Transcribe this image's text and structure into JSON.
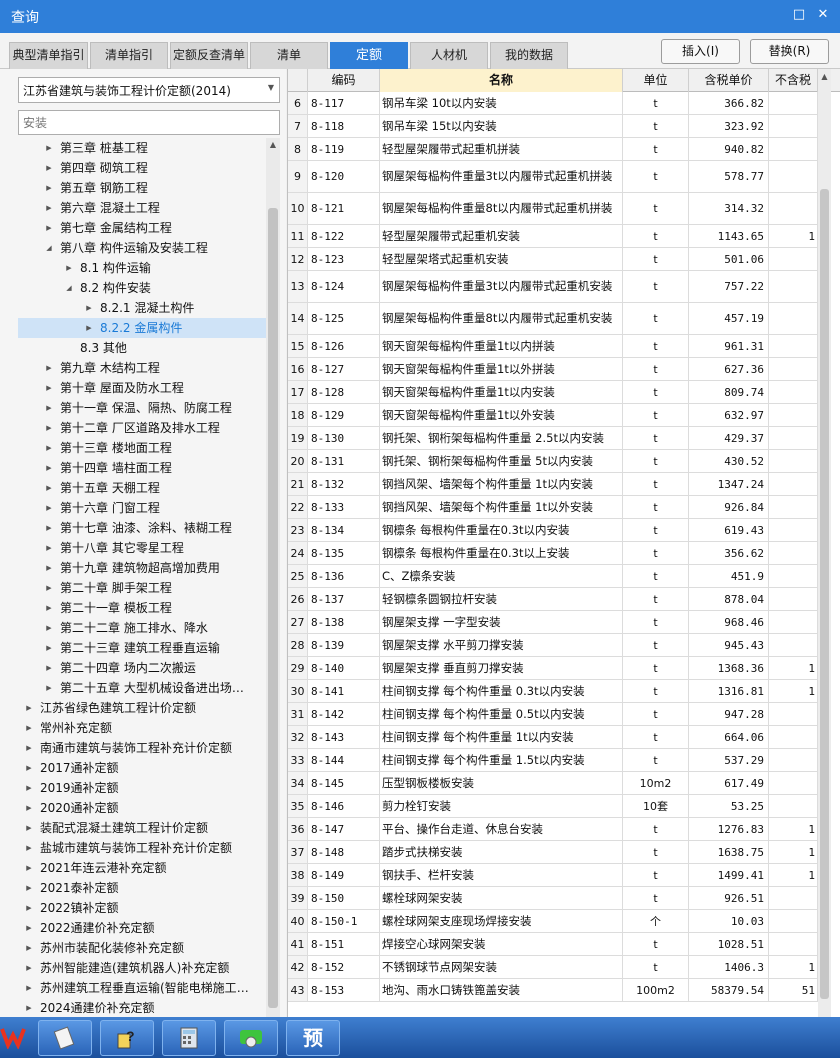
{
  "window": {
    "title": "查询",
    "restore_glyph": "□",
    "close_glyph": "✕"
  },
  "tabs": [
    {
      "label": "典型清单指引"
    },
    {
      "label": "清单指引"
    },
    {
      "label": "定额反查清单"
    },
    {
      "label": "清单"
    },
    {
      "label": "定额",
      "active": true
    },
    {
      "label": "人材机"
    },
    {
      "label": "我的数据"
    }
  ],
  "actions": {
    "insert": "插入(I)",
    "replace": "替换(R)"
  },
  "library": {
    "selected": "江苏省建筑与装饰工程计价定额(2014)",
    "search_placeholder": "安装"
  },
  "tree": [
    {
      "label": "第三章 桩基工程",
      "level": 2,
      "state": "collapsed"
    },
    {
      "label": "第四章 砌筑工程",
      "level": 2,
      "state": "collapsed"
    },
    {
      "label": "第五章 钢筋工程",
      "level": 2,
      "state": "collapsed"
    },
    {
      "label": "第六章 混凝土工程",
      "level": 2,
      "state": "collapsed"
    },
    {
      "label": "第七章 金属结构工程",
      "level": 2,
      "state": "collapsed"
    },
    {
      "label": "第八章 构件运输及安装工程",
      "level": 2,
      "state": "expanded"
    },
    {
      "label": "8.1 构件运输",
      "level": 3,
      "state": "collapsed"
    },
    {
      "label": "8.2 构件安装",
      "level": 3,
      "state": "expanded"
    },
    {
      "label": "8.2.1 混凝土构件",
      "level": 4,
      "state": "collapsed"
    },
    {
      "label": "8.2.2 金属构件",
      "level": 4,
      "state": "collapsed",
      "selected": true
    },
    {
      "label": "8.3 其他",
      "level": 3,
      "state": "leaf"
    },
    {
      "label": "第九章 木结构工程",
      "level": 2,
      "state": "collapsed"
    },
    {
      "label": "第十章 屋面及防水工程",
      "level": 2,
      "state": "collapsed"
    },
    {
      "label": "第十一章 保温、隔热、防腐工程",
      "level": 2,
      "state": "collapsed"
    },
    {
      "label": "第十二章 厂区道路及排水工程",
      "level": 2,
      "state": "collapsed"
    },
    {
      "label": "第十三章 楼地面工程",
      "level": 2,
      "state": "collapsed"
    },
    {
      "label": "第十四章 墙柱面工程",
      "level": 2,
      "state": "collapsed"
    },
    {
      "label": "第十五章 天棚工程",
      "level": 2,
      "state": "collapsed"
    },
    {
      "label": "第十六章 门窗工程",
      "level": 2,
      "state": "collapsed"
    },
    {
      "label": "第十七章 油漆、涂料、裱糊工程",
      "level": 2,
      "state": "collapsed"
    },
    {
      "label": "第十八章 其它零星工程",
      "level": 2,
      "state": "collapsed"
    },
    {
      "label": "第十九章 建筑物超高增加费用",
      "level": 2,
      "state": "collapsed"
    },
    {
      "label": "第二十章 脚手架工程",
      "level": 2,
      "state": "collapsed"
    },
    {
      "label": "第二十一章 模板工程",
      "level": 2,
      "state": "collapsed"
    },
    {
      "label": "第二十二章 施工排水、降水",
      "level": 2,
      "state": "collapsed"
    },
    {
      "label": "第二十三章 建筑工程垂直运输",
      "level": 2,
      "state": "collapsed"
    },
    {
      "label": "第二十四章 场内二次搬运",
      "level": 2,
      "state": "collapsed"
    },
    {
      "label": "第二十五章 大型机械设备进出场及…",
      "level": 2,
      "state": "collapsed"
    },
    {
      "label": "江苏省绿色建筑工程计价定额",
      "level": 1,
      "state": "collapsed"
    },
    {
      "label": "常州补充定额",
      "level": 1,
      "state": "collapsed"
    },
    {
      "label": "南通市建筑与装饰工程补充计价定额",
      "level": 1,
      "state": "collapsed"
    },
    {
      "label": "2017通补定额",
      "level": 1,
      "state": "collapsed"
    },
    {
      "label": "2019通补定额",
      "level": 1,
      "state": "collapsed"
    },
    {
      "label": "2020通补定额",
      "level": 1,
      "state": "collapsed"
    },
    {
      "label": "装配式混凝土建筑工程计价定额",
      "level": 1,
      "state": "collapsed"
    },
    {
      "label": "盐城市建筑与装饰工程补充计价定额",
      "level": 1,
      "state": "collapsed"
    },
    {
      "label": "2021年连云港补充定额",
      "level": 1,
      "state": "collapsed"
    },
    {
      "label": "2021泰补定额",
      "level": 1,
      "state": "collapsed"
    },
    {
      "label": "2022镇补定额",
      "level": 1,
      "state": "collapsed"
    },
    {
      "label": "2022通建价补充定额",
      "level": 1,
      "state": "collapsed"
    },
    {
      "label": "苏州市装配化装修补充定额",
      "level": 1,
      "state": "collapsed"
    },
    {
      "label": "苏州智能建造(建筑机器人)补充定额",
      "level": 1,
      "state": "collapsed"
    },
    {
      "label": "苏州建筑工程垂直运输(智能电梯施工)…",
      "level": 1,
      "state": "collapsed"
    },
    {
      "label": "2024通建价补充定额",
      "level": 1,
      "state": "collapsed"
    }
  ],
  "grid": {
    "columns": {
      "code": "编码",
      "name": "名称",
      "unit": "单位",
      "price": "含税单价",
      "price2": "不含税"
    },
    "rows": [
      {
        "idx": "6",
        "code": "8-117",
        "name": "钢吊车梁 10t以内安装",
        "unit": "t",
        "price": "366.82",
        "price2": "",
        "tall": false
      },
      {
        "idx": "7",
        "code": "8-118",
        "name": "钢吊车梁 15t以内安装",
        "unit": "t",
        "price": "323.92",
        "price2": "",
        "tall": false
      },
      {
        "idx": "8",
        "code": "8-119",
        "name": "轻型屋架履带式起重机拼装",
        "unit": "t",
        "price": "940.82",
        "price2": "",
        "tall": false
      },
      {
        "idx": "9",
        "code": "8-120",
        "name": "钢屋架每榀构件重量3t以内履带式起重机拼装",
        "unit": "t",
        "price": "578.77",
        "price2": "",
        "tall": true
      },
      {
        "idx": "10",
        "code": "8-121",
        "name": "钢屋架每榀构件重量8t以内履带式起重机拼装",
        "unit": "t",
        "price": "314.32",
        "price2": "",
        "tall": true
      },
      {
        "idx": "11",
        "code": "8-122",
        "name": "轻型屋架履带式起重机安装",
        "unit": "t",
        "price": "1143.65",
        "price2": "1",
        "tall": false
      },
      {
        "idx": "12",
        "code": "8-123",
        "name": "轻型屋架塔式起重机安装",
        "unit": "t",
        "price": "501.06",
        "price2": "",
        "tall": false
      },
      {
        "idx": "13",
        "code": "8-124",
        "name": "钢屋架每榀构件重量3t以内履带式起重机安装",
        "unit": "t",
        "price": "757.22",
        "price2": "",
        "tall": true
      },
      {
        "idx": "14",
        "code": "8-125",
        "name": "钢屋架每榀构件重量8t以内履带式起重机安装",
        "unit": "t",
        "price": "457.19",
        "price2": "",
        "tall": true
      },
      {
        "idx": "15",
        "code": "8-126",
        "name": "钢天窗架每榀构件重量1t以内拼装",
        "unit": "t",
        "price": "961.31",
        "price2": "",
        "tall": false
      },
      {
        "idx": "16",
        "code": "8-127",
        "name": "钢天窗架每榀构件重量1t以外拼装",
        "unit": "t",
        "price": "627.36",
        "price2": "",
        "tall": false
      },
      {
        "idx": "17",
        "code": "8-128",
        "name": "钢天窗架每榀构件重量1t以内安装",
        "unit": "t",
        "price": "809.74",
        "price2": "",
        "tall": false
      },
      {
        "idx": "18",
        "code": "8-129",
        "name": "钢天窗架每榀构件重量1t以外安装",
        "unit": "t",
        "price": "632.97",
        "price2": "",
        "tall": false
      },
      {
        "idx": "19",
        "code": "8-130",
        "name": "钢托架、钢桁架每榀构件重量 2.5t以内安装",
        "unit": "t",
        "price": "429.37",
        "price2": "",
        "tall": false
      },
      {
        "idx": "20",
        "code": "8-131",
        "name": "钢托架、钢桁架每榀构件重量 5t以内安装",
        "unit": "t",
        "price": "430.52",
        "price2": "",
        "tall": false
      },
      {
        "idx": "21",
        "code": "8-132",
        "name": "钢挡风架、墙架每个构件重量 1t以内安装",
        "unit": "t",
        "price": "1347.24",
        "price2": "",
        "tall": false
      },
      {
        "idx": "22",
        "code": "8-133",
        "name": "钢挡风架、墙架每个构件重量 1t以外安装",
        "unit": "t",
        "price": "926.84",
        "price2": "",
        "tall": false
      },
      {
        "idx": "23",
        "code": "8-134",
        "name": "钢檩条 每根构件重量在0.3t以内安装",
        "unit": "t",
        "price": "619.43",
        "price2": "",
        "tall": false
      },
      {
        "idx": "24",
        "code": "8-135",
        "name": "钢檩条 每根构件重量在0.3t以上安装",
        "unit": "t",
        "price": "356.62",
        "price2": "",
        "tall": false
      },
      {
        "idx": "25",
        "code": "8-136",
        "name": "C、Z檩条安装",
        "unit": "t",
        "price": "451.9",
        "price2": "",
        "tall": false
      },
      {
        "idx": "26",
        "code": "8-137",
        "name": "轻钢檩条圆钢拉杆安装",
        "unit": "t",
        "price": "878.04",
        "price2": "",
        "tall": false
      },
      {
        "idx": "27",
        "code": "8-138",
        "name": "钢屋架支撑 一字型安装",
        "unit": "t",
        "price": "968.46",
        "price2": "",
        "tall": false
      },
      {
        "idx": "28",
        "code": "8-139",
        "name": "钢屋架支撑 水平剪刀撑安装",
        "unit": "t",
        "price": "945.43",
        "price2": "",
        "tall": false
      },
      {
        "idx": "29",
        "code": "8-140",
        "name": "钢屋架支撑 垂直剪刀撑安装",
        "unit": "t",
        "price": "1368.36",
        "price2": "1",
        "tall": false
      },
      {
        "idx": "30",
        "code": "8-141",
        "name": "柱间钢支撑 每个构件重量 0.3t以内安装",
        "unit": "t",
        "price": "1316.81",
        "price2": "1",
        "tall": false
      },
      {
        "idx": "31",
        "code": "8-142",
        "name": "柱间钢支撑 每个构件重量 0.5t以内安装",
        "unit": "t",
        "price": "947.28",
        "price2": "",
        "tall": false
      },
      {
        "idx": "32",
        "code": "8-143",
        "name": "柱间钢支撑 每个构件重量 1t以内安装",
        "unit": "t",
        "price": "664.06",
        "price2": "",
        "tall": false
      },
      {
        "idx": "33",
        "code": "8-144",
        "name": "柱间钢支撑 每个构件重量 1.5t以内安装",
        "unit": "t",
        "price": "537.29",
        "price2": "",
        "tall": false
      },
      {
        "idx": "34",
        "code": "8-145",
        "name": "压型钢板楼板安装",
        "unit": "10m2",
        "price": "617.49",
        "price2": "",
        "tall": false
      },
      {
        "idx": "35",
        "code": "8-146",
        "name": "剪力栓钉安装",
        "unit": "10套",
        "price": "53.25",
        "price2": "",
        "tall": false
      },
      {
        "idx": "36",
        "code": "8-147",
        "name": "平台、操作台走道、休息台安装",
        "unit": "t",
        "price": "1276.83",
        "price2": "1",
        "tall": false
      },
      {
        "idx": "37",
        "code": "8-148",
        "name": "踏步式扶梯安装",
        "unit": "t",
        "price": "1638.75",
        "price2": "1",
        "tall": false
      },
      {
        "idx": "38",
        "code": "8-149",
        "name": "钢扶手、栏杆安装",
        "unit": "t",
        "price": "1499.41",
        "price2": "1",
        "tall": false
      },
      {
        "idx": "39",
        "code": "8-150",
        "name": "螺栓球网架安装",
        "unit": "t",
        "price": "926.51",
        "price2": "",
        "tall": false
      },
      {
        "idx": "40",
        "code": "8-150-1",
        "name": "螺栓球网架支座现场焊接安装",
        "unit": "个",
        "price": "10.03",
        "price2": "",
        "tall": false
      },
      {
        "idx": "41",
        "code": "8-151",
        "name": "焊接空心球网架安装",
        "unit": "t",
        "price": "1028.51",
        "price2": "",
        "tall": false
      },
      {
        "idx": "42",
        "code": "8-152",
        "name": "不锈钢球节点网架安装",
        "unit": "t",
        "price": "1406.3",
        "price2": "1",
        "tall": false
      },
      {
        "idx": "43",
        "code": "8-153",
        "name": "地沟、雨水口铸铁篦盖安装",
        "unit": "100m2",
        "price": "58379.54",
        "price2": "51",
        "tall": false
      }
    ]
  },
  "taskbar": {
    "items": [
      {
        "name": "app-logo-icon"
      },
      {
        "name": "documents-icon"
      },
      {
        "name": "help-icon"
      },
      {
        "name": "calculator-icon"
      },
      {
        "name": "chat-icon"
      },
      {
        "name": "quota-preview-icon",
        "glyph": "预"
      }
    ]
  },
  "colors": {
    "accent": "#2f7fd9",
    "selected_row": "#cfe3f7",
    "name_header": "#fdf2cd"
  }
}
